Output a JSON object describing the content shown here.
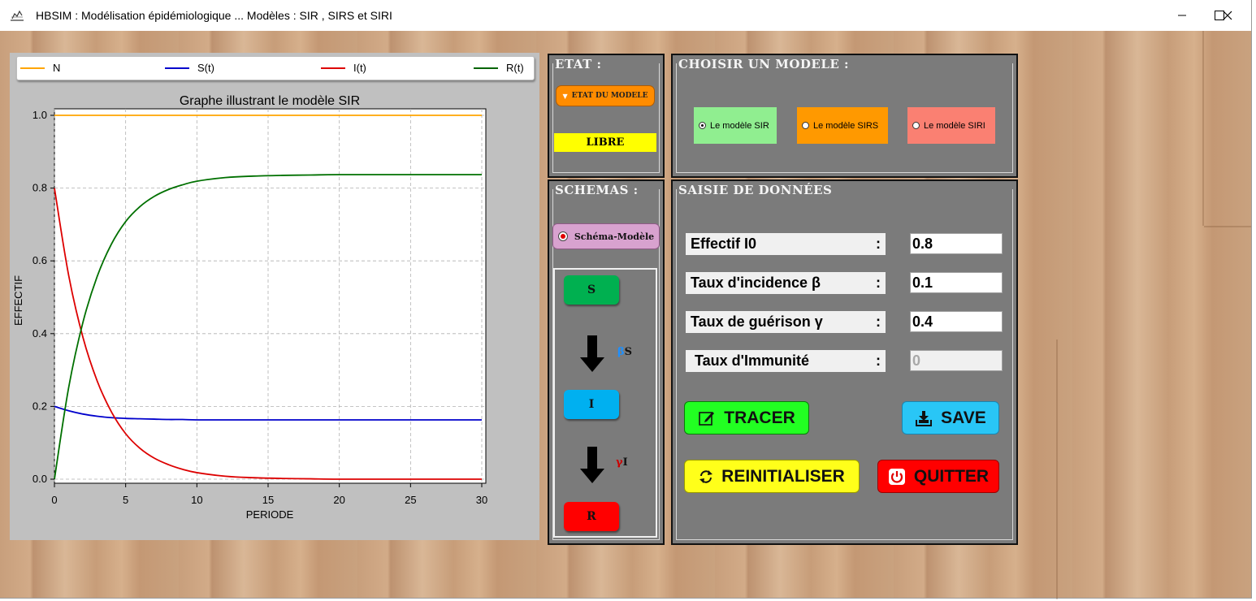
{
  "window": {
    "title": "HBSIM : Modélisation épidémiologique ... Modèles : SIR , SIRS et SIRI",
    "controls": [
      "minimize",
      "maximize",
      "close"
    ]
  },
  "legend": {
    "items": [
      {
        "label": "N",
        "color": "#ffa500"
      },
      {
        "label": "S(t)",
        "color": "#0000cc"
      },
      {
        "label": "I(t)",
        "color": "#dd0000"
      },
      {
        "label": "R(t)",
        "color": "#006400"
      }
    ]
  },
  "chart_data": {
    "type": "line",
    "title": "Graphe illustrant le modèle SIR",
    "xlabel": "PERIODE",
    "ylabel": "EFFECTIF",
    "xlim": [
      0,
      30
    ],
    "ylim": [
      0,
      1.0
    ],
    "xticks": [
      "0",
      "5",
      "10",
      "15",
      "20",
      "25",
      "30"
    ],
    "yticks": [
      "0.0",
      "0.2",
      "0.4",
      "0.6",
      "0.8",
      "1.0"
    ],
    "grid": true,
    "legend_position": "top",
    "x": [
      0,
      1,
      2,
      3,
      4,
      5,
      6,
      7,
      8,
      9,
      10,
      12,
      14,
      16,
      18,
      20,
      25,
      30
    ],
    "series": [
      {
        "name": "N",
        "color": "#ffa500",
        "values": [
          1.0,
          1.0,
          1.0,
          1.0,
          1.0,
          1.0,
          1.0,
          1.0,
          1.0,
          1.0,
          1.0,
          1.0,
          1.0,
          1.0,
          1.0,
          1.0,
          1.0,
          1.0
        ]
      },
      {
        "name": "S(t)",
        "color": "#0000cc",
        "values": [
          0.2,
          0.188,
          0.179,
          0.173,
          0.169,
          0.167,
          0.166,
          0.165,
          0.164,
          0.164,
          0.163,
          0.163,
          0.163,
          0.163,
          0.163,
          0.163,
          0.163,
          0.163
        ]
      },
      {
        "name": "I(t)",
        "color": "#dd0000",
        "values": [
          0.8,
          0.56,
          0.39,
          0.27,
          0.185,
          0.125,
          0.085,
          0.058,
          0.04,
          0.027,
          0.018,
          0.008,
          0.004,
          0.002,
          0.001,
          0.0,
          0.0,
          0.0
        ]
      },
      {
        "name": "R(t)",
        "color": "#007000",
        "values": [
          0.0,
          0.252,
          0.431,
          0.557,
          0.646,
          0.708,
          0.749,
          0.777,
          0.796,
          0.809,
          0.819,
          0.829,
          0.833,
          0.835,
          0.836,
          0.837,
          0.837,
          0.837
        ]
      }
    ]
  },
  "etat": {
    "title": "ETAT :",
    "button_label": "ETAT DU MODELE",
    "status": "LIBRE",
    "status_color": "#ffff00"
  },
  "choisir": {
    "title": "CHOISIR UN MODELE :",
    "options": [
      {
        "label": "Le modèle SIR",
        "color": "#90ee90",
        "checked": true
      },
      {
        "label": "Le modèle  SIRS",
        "color": "#ff9900",
        "checked": false
      },
      {
        "label": "Le modèle  SIRI",
        "color": "#fa8072",
        "checked": false
      }
    ]
  },
  "schemas": {
    "title": "SCHEMAS :",
    "button_label": "Schéma-Modèle",
    "nodes": [
      {
        "label": "S",
        "color": "#00b050"
      },
      {
        "label": "I",
        "color": "#00b0f0"
      },
      {
        "label": "R",
        "color": "#ff0000"
      }
    ],
    "rates": [
      {
        "greek": "β",
        "var": "S",
        "color": "#1e90ff"
      },
      {
        "greek": "γ",
        "var": "I",
        "color": "#cc0000"
      }
    ]
  },
  "saisie": {
    "title": "SAISIE DE DONNÉES",
    "fields": [
      {
        "label": "Effectif I0",
        "value": "0.8",
        "enabled": true
      },
      {
        "label": "Taux d'incidence  β",
        "value": "0.1",
        "enabled": true
      },
      {
        "label": "Taux de guérison γ",
        "value": "0.4",
        "enabled": true
      },
      {
        "label": " Taux d'Immunité",
        "value": "0",
        "enabled": false
      }
    ],
    "buttons": {
      "tracer": "TRACER",
      "save": "SAVE",
      "reinit": "REINITIALISER",
      "quitter": "QUITTER"
    }
  }
}
